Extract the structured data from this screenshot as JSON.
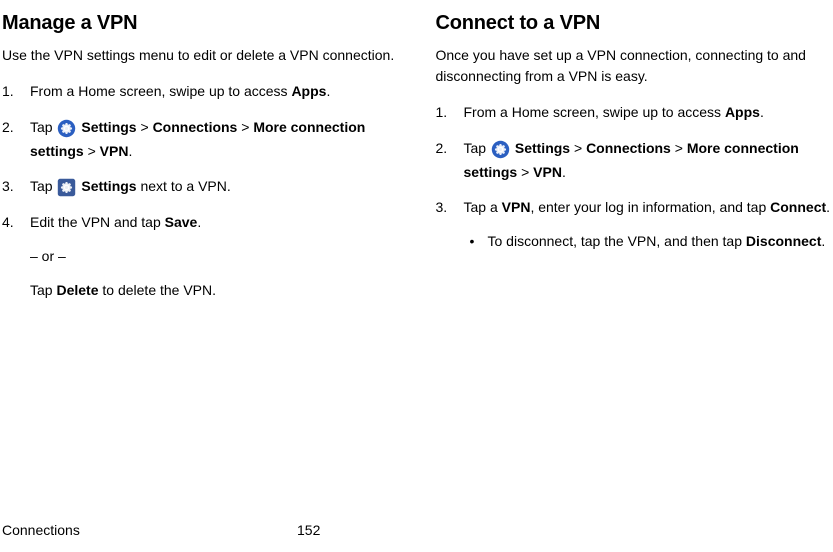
{
  "left": {
    "title": "Manage a VPN",
    "intro": "Use the VPN settings menu to edit or delete a VPN connection.",
    "step1_a": "From a Home screen, swipe up to access ",
    "step1_b": "Apps",
    "step1_c": ".",
    "step2_a": "Tap ",
    "step2_b": " Settings",
    "step2_c": " > ",
    "step2_d": "Connections",
    "step2_e": " > ",
    "step2_f": "More connection settings",
    "step2_g": " > ",
    "step2_h": "VPN",
    "step2_i": ".",
    "step3_a": "Tap ",
    "step3_b": " Settings",
    "step3_c": " next to a VPN.",
    "step4_a": "Edit the VPN and tap ",
    "step4_b": "Save",
    "step4_c": ".",
    "or": "– or –",
    "step4_d": "Tap ",
    "step4_e": "Delete",
    "step4_f": " to delete the VPN."
  },
  "right": {
    "title": "Connect to a VPN",
    "intro": "Once you have set up a VPN connection, connecting to and disconnecting from a VPN is easy.",
    "step1_a": "From a Home screen, swipe up to access ",
    "step1_b": "Apps",
    "step1_c": ".",
    "step2_a": "Tap ",
    "step2_b": " Settings",
    "step2_c": " > ",
    "step2_d": "Connections",
    "step2_e": " > ",
    "step2_f": "More connection settings",
    "step2_g": " > ",
    "step2_h": "VPN",
    "step2_i": ".",
    "step3_a": "Tap a ",
    "step3_b": "VPN",
    "step3_c": ", enter your log in information, and tap ",
    "step3_d": "Connect",
    "step3_e": ".",
    "bullet_a": "To disconnect, tap the VPN, and then tap ",
    "bullet_b": "Disconnect",
    "bullet_c": "."
  },
  "footer": {
    "section": "Connections",
    "page": "152"
  }
}
